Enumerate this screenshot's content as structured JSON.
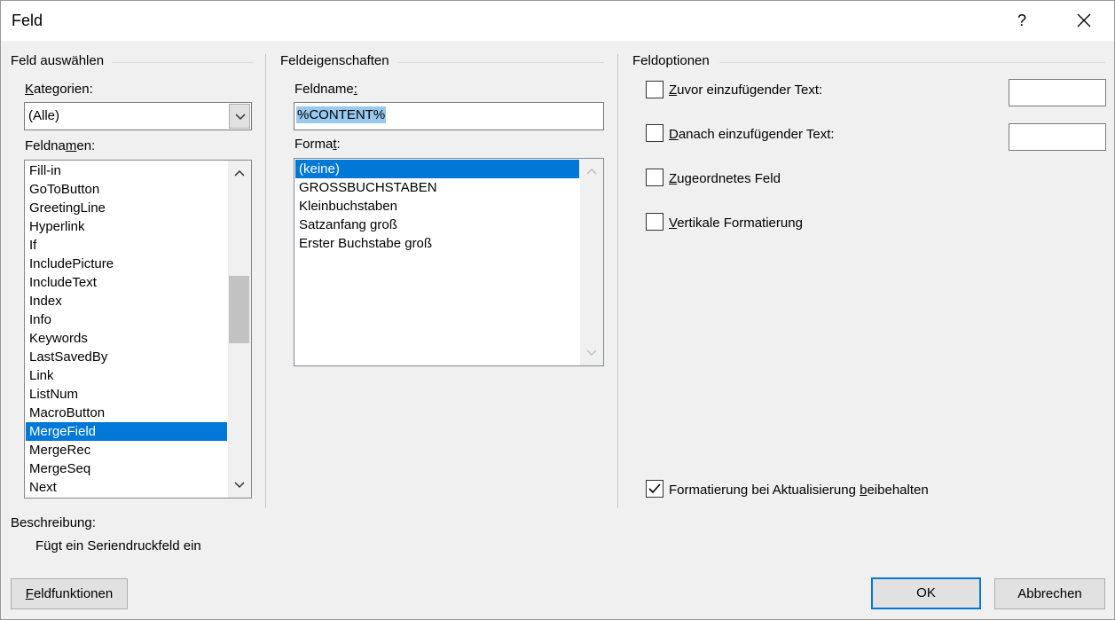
{
  "window": {
    "title": "Feld",
    "help_label": "?"
  },
  "select_field": {
    "heading": "Feld auswählen",
    "categories_label": {
      "before": "",
      "mnemonic": "K",
      "after": "ategorien:"
    },
    "categories_value": "(Alle)",
    "fieldnames_label": {
      "before": "Feldna",
      "mnemonic": "m",
      "after": "en:"
    },
    "fieldnames": [
      "Fill-in",
      "GoToButton",
      "GreetingLine",
      "Hyperlink",
      "If",
      "IncludePicture",
      "IncludeText",
      "Index",
      "Info",
      "Keywords",
      "LastSavedBy",
      "Link",
      "ListNum",
      "MacroButton",
      "MergeField",
      "MergeRec",
      "MergeSeq",
      "Next"
    ],
    "selected_fieldname": "MergeField"
  },
  "properties": {
    "heading": "Feldeigenschaften",
    "fieldname_label": {
      "before": "Feldname",
      "mnemonic": ":",
      "after": ""
    },
    "fieldname_value": "%CONTENT%",
    "format_label": {
      "before": "Forma",
      "mnemonic": "t",
      "after": ":"
    },
    "formats": [
      "(keine)",
      "GROSSBUCHSTABEN",
      "Kleinbuchstaben",
      "Satzanfang groß",
      "Erster Buchstabe groß"
    ],
    "selected_format": "(keine)"
  },
  "options": {
    "heading": "Feldoptionen",
    "before_text": {
      "before": "",
      "mnemonic": "Z",
      "after": "uvor einzufügender Text:",
      "checked": false,
      "value": ""
    },
    "after_text": {
      "before": "",
      "mnemonic": "D",
      "after": "anach einzufügender Text:",
      "checked": false,
      "value": ""
    },
    "mapped_field": {
      "before": "",
      "mnemonic": "Z",
      "after": "ugeordnetes Feld",
      "checked": false
    },
    "vertical_format": {
      "before": "",
      "mnemonic": "V",
      "after": "ertikale Formatierung",
      "checked": false
    },
    "preserve_format": {
      "before": "Formatierung bei Aktualisierung ",
      "mnemonic": "b",
      "after": "eibehalten",
      "checked": true
    }
  },
  "description": {
    "label": "Beschreibung:",
    "text": "Fügt ein Seriendruckfeld ein"
  },
  "buttons": {
    "field_codes": {
      "before": "",
      "mnemonic": "F",
      "after": "eldfunktionen"
    },
    "ok": "OK",
    "cancel": "Abbrechen"
  }
}
